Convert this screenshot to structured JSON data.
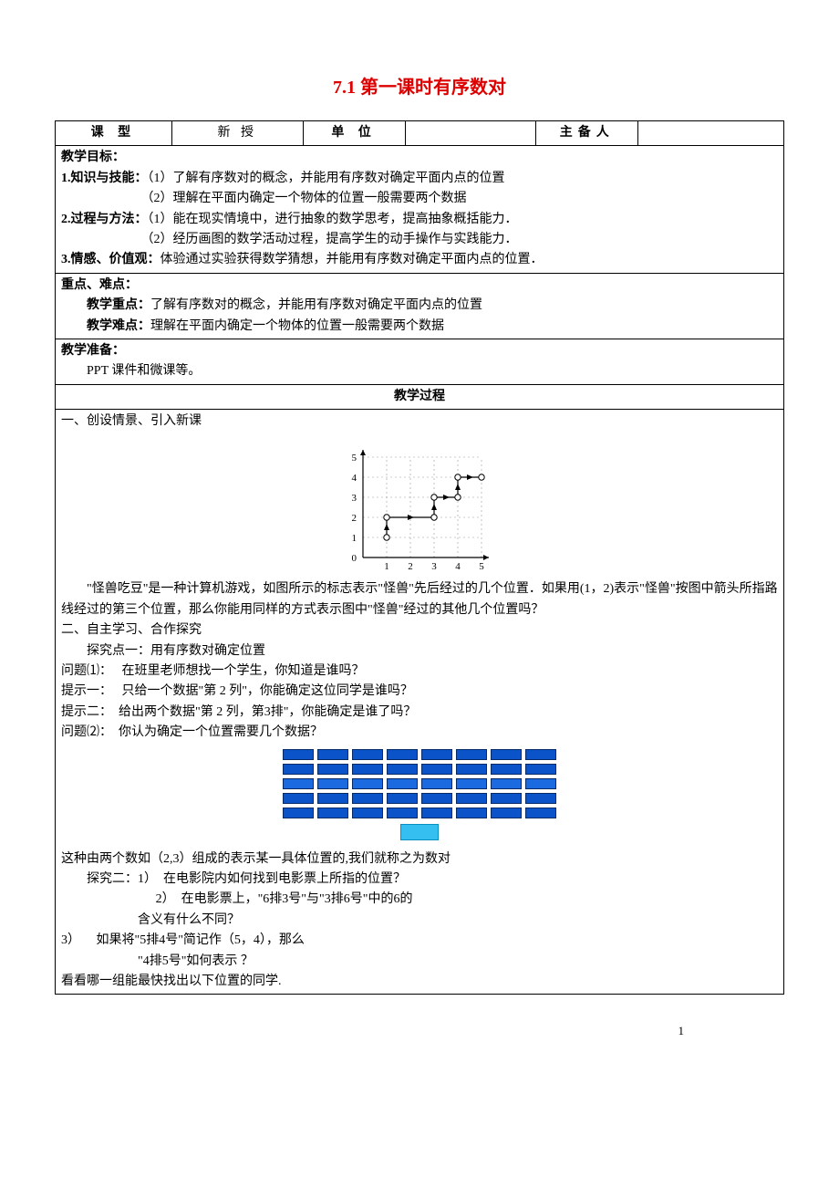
{
  "title": "7.1 第一课时有序数对",
  "header": {
    "col1": "课  型",
    "col2": "新  授",
    "col3": "单 位",
    "col4": "",
    "col5": "主备人",
    "col6": ""
  },
  "objectives": {
    "heading": "教学目标：",
    "k_label": "1.知识与技能：",
    "k1": "（1）了解有序数对的概念，并能用有序数对确定平面内点的位置",
    "k2": "（2）理解在平面内确定一个物体的位置一般需要两个数据",
    "p_label": "2.过程与方法：",
    "p1": "（1）能在现实情境中，进行抽象的数学思考，提高抽象概括能力．",
    "p2": "（2）经历画图的数学活动过程，提高学生的动手操作与实践能力．",
    "v_label": "3.情感、价值观：",
    "v1": "体验通过实验获得数学猜想，并能用有序数对确定平面内点的位置．"
  },
  "keypoints": {
    "heading": "重点、难点：",
    "k_label": "教学重点：",
    "k_text": "了解有序数对的概念，并能用有序数对确定平面内点的位置",
    "d_label": "教学难点：",
    "d_text": "理解在平面内确定一个物体的位置一般需要两个数据"
  },
  "prep": {
    "heading": "教学准备：",
    "text": "PPT 课件和微课等。"
  },
  "process_heading": "教学过程",
  "process": {
    "sec1": "一、创设情景、引入新课",
    "para1": "\"怪兽吃豆\"是一种计算机游戏，如图所示的标志表示\"怪兽\"先后经过的几个位置．如果用(1，2)表示\"怪兽\"按图中箭头所指路线经过的第三个位置，那么你能用同样的方式表示图中\"怪兽\"经过的其他几个位置吗？",
    "sec2": "二、自主学习、合作探究",
    "t1": "探究点一：用有序数对确定位置",
    "q1_label": "问题⑴：",
    "q1": "在班里老师想找一个学生，你知道是谁吗？",
    "h1_label": "提示一：",
    "h1": "只给一个数据\"第 2 列\"，你能确定这位同学是谁吗？",
    "h2_label": "提示二：",
    "h2": "给出两个数据\"第 2 列，第3排\"，你能确定是谁了吗？",
    "q2_label": "问题⑵：",
    "q2": "你认为确定一个位置需要几个数据？",
    "conclusion": "这种由两个数如（2,3）组成的表示某一具体位置的,我们就称之为数对",
    "t2_label": "探究二：",
    "t2_1_label": "1）",
    "t2_1": "在电影院内如何找到电影票上所指的位置？",
    "t2_2_label": "2）",
    "t2_2": "在电影票上，\"6排3号\"与\"3排6号\"中的6的",
    "t2_2b": "含义有什么不同？",
    "t2_3_label": "3）",
    "t2_3": "如果将\"5排4号\"简记作（5，4），那么",
    "t2_3b": "\"4排5号\"如何表示  ？",
    "final": "看看哪一组能最快找出以下位置的同学."
  },
  "chart_data": {
    "type": "line",
    "title": "",
    "xlabel": "",
    "ylabel": "",
    "x_ticks": [
      1,
      2,
      3,
      4,
      5
    ],
    "y_ticks": [
      0,
      1,
      2,
      3,
      4,
      5
    ],
    "xlim": [
      0,
      5
    ],
    "ylim": [
      0,
      5
    ],
    "points": [
      {
        "x": 1,
        "y": 1
      },
      {
        "x": 1,
        "y": 2
      },
      {
        "x": 3,
        "y": 2
      },
      {
        "x": 3,
        "y": 3
      },
      {
        "x": 4,
        "y": 3
      },
      {
        "x": 4,
        "y": 4
      },
      {
        "x": 5,
        "y": 4
      }
    ],
    "open_markers": [
      {
        "x": 1,
        "y": 1
      },
      {
        "x": 1,
        "y": 2
      },
      {
        "x": 3,
        "y": 2
      },
      {
        "x": 3,
        "y": 3
      },
      {
        "x": 4,
        "y": 3
      },
      {
        "x": 4,
        "y": 4
      },
      {
        "x": 5,
        "y": 4
      }
    ]
  },
  "seat_layout": {
    "rows": 5,
    "cols": 8,
    "middle_row_index": 2
  },
  "page_number": "1"
}
